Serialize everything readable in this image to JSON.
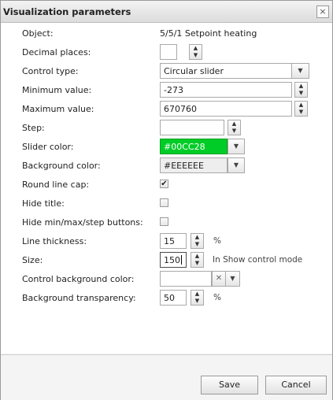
{
  "dialog": {
    "title": "Visualization parameters",
    "close_label": "×"
  },
  "object": {
    "label": "Object:",
    "value": "5/5/1 Setpoint heating"
  },
  "decimal_places": {
    "label": "Decimal places:",
    "value": ""
  },
  "control_type": {
    "label": "Control type:",
    "value": "Circular slider"
  },
  "minimum_value": {
    "label": "Minimum value:",
    "value": "-273"
  },
  "maximum_value": {
    "label": "Maximum value:",
    "value": "670760"
  },
  "step": {
    "label": "Step:",
    "value": ""
  },
  "slider_color": {
    "label": "Slider color:",
    "value": "#00CC28",
    "color": "#00CC28",
    "text_color": "#ffffff"
  },
  "background_color": {
    "label": "Background color:",
    "value": "#EEEEEE",
    "color": "#EEEEEE"
  },
  "round_line_cap": {
    "label": "Round line cap:",
    "checked": true,
    "mark": "✔"
  },
  "hide_title": {
    "label": "Hide title:",
    "checked": false,
    "mark": ""
  },
  "hide_buttons": {
    "label": "Hide min/max/step buttons:",
    "checked": false,
    "mark": ""
  },
  "line_thickness": {
    "label": "Line thickness:",
    "value": "15",
    "unit": "%"
  },
  "size": {
    "label": "Size:",
    "value": "150",
    "note": "In Show control mode"
  },
  "control_bg_color": {
    "label": "Control background color:",
    "value": "",
    "clear_label": "✕"
  },
  "bg_transparency": {
    "label": "Background transparency:",
    "value": "50",
    "unit": "%"
  },
  "icons": {
    "spin_up": "▲",
    "spin_down": "▼",
    "dropdown": "▼"
  },
  "footer": {
    "save_label": "Save",
    "cancel_label": "Cancel"
  }
}
